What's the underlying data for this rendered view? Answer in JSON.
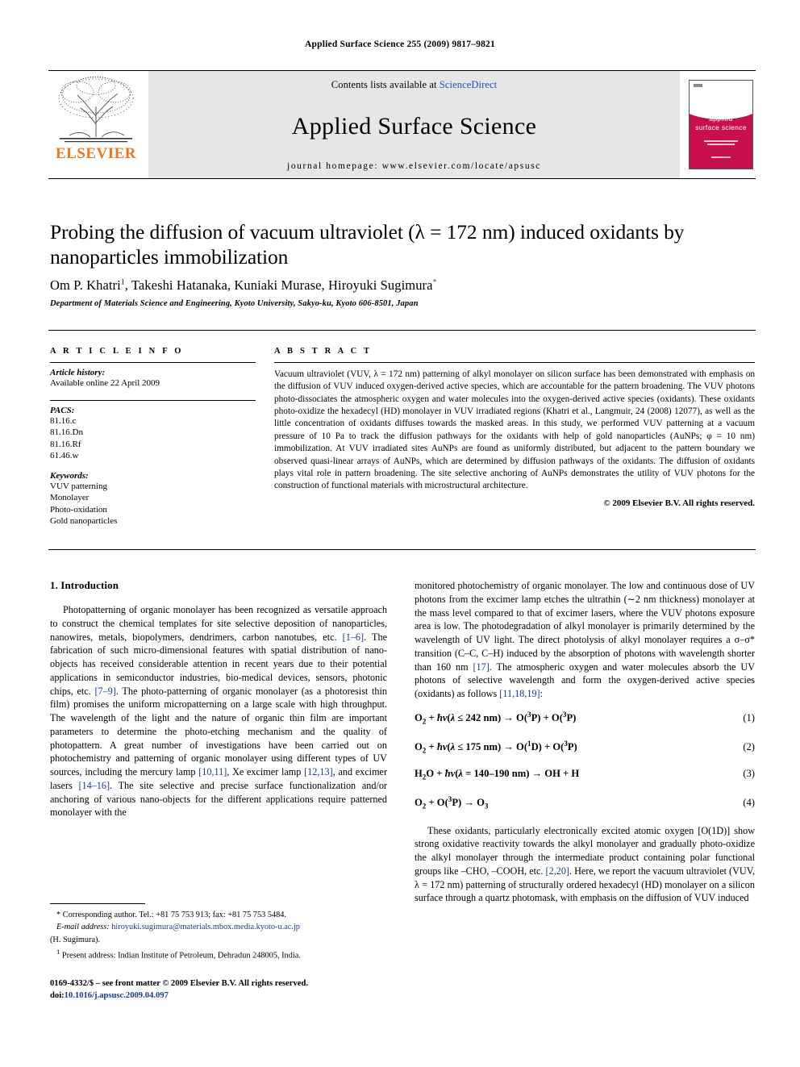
{
  "running_head": "Applied Surface Science 255 (2009) 9817–9821",
  "masthead": {
    "publisher": "ELSEVIER",
    "contents_prefix": "Contents lists available at ",
    "sciencedirect": "ScienceDirect",
    "journal_name": "Applied Surface Science",
    "homepage": "journal homepage: www.elsevier.com/locate/apsusc",
    "cover_title_line1": "applied",
    "cover_title_line2": "surface science",
    "cover_color": "#c8104e",
    "elsevier_orange": "#E87722",
    "link_color": "#1a4fbd"
  },
  "article": {
    "title": "Probing the diffusion of vacuum ultraviolet (λ = 172 nm) induced oxidants by nanoparticles immobilization",
    "authors_text": "Om P. Khatri",
    "authors_mid": ", Takeshi Hatanaka, Kuniaki Murase, Hiroyuki Sugimura",
    "author_footnote_marker": "1",
    "corresponding_marker": "*",
    "affiliation": "Department of Materials Science and Engineering, Kyoto University, Sakyo-ku, Kyoto 606-8501, Japan"
  },
  "article_info": {
    "heading": "A R T I C L E   I N F O",
    "history_label": "Article history:",
    "history_value": "Available online 22 April 2009",
    "pacs_label": "PACS:",
    "pacs": [
      "81.16.c",
      "81.16.Dn",
      "81.16.Rf",
      "61.46.w"
    ],
    "keywords_label": "Keywords:",
    "keywords": [
      "VUV patterning",
      "Monolayer",
      "Photo-oxidation",
      "Gold nanoparticles"
    ]
  },
  "abstract": {
    "heading": "A B S T R A C T",
    "text": "Vacuum ultraviolet (VUV, λ = 172 nm) patterning of alkyl monolayer on silicon surface has been demonstrated with emphasis on the diffusion of VUV induced oxygen-derived active species, which are accountable for the pattern broadening. The VUV photons photo-dissociates the atmospheric oxygen and water molecules into the oxygen-derived active species (oxidants). These oxidants photo-oxidize the hexadecyl (HD) monolayer in VUV irradiated regions (Khatri et al., Langmuir, 24 (2008) 12077), as well as the little concentration of oxidants diffuses towards the masked areas. In this study, we performed VUV patterning at a vacuum pressure of 10 Pa to track the diffusion pathways for the oxidants with help of gold nanoparticles (AuNPs; φ = 10 nm) immobilization. At VUV irradiated sites AuNPs are found as uniformly distributed, but adjacent to the pattern boundary we observed quasi-linear arrays of AuNPs, which are determined by diffusion pathways of the oxidants. The diffusion of oxidants plays vital role in pattern broadening. The site selective anchoring of AuNPs demonstrates the utility of VUV photons for the construction of functional materials with microstructural architecture.",
    "copyright": "© 2009 Elsevier B.V. All rights reserved."
  },
  "body": {
    "section_heading": "1. Introduction",
    "left_p1_a": "Photopatterning of organic monolayer has been recognized as versatile approach to construct the chemical templates for site selective deposition of nanoparticles, nanowires, metals, biopolymers, dendrimers, carbon nanotubes, etc. ",
    "left_ref1": "[1–6]",
    "left_p1_b": ". The fabrication of such micro-dimensional features with spatial distribution of nano-objects has received considerable attention in recent years due to their potential applications in semiconductor industries, bio-medical devices, sensors, photonic chips, etc. ",
    "left_ref2": "[7–9]",
    "left_p1_c": ". The photo-patterning of organic monolayer (as a photoresist thin film) promises the uniform micropatterning on a large scale with high throughput. The wavelength of the light and the nature of organic thin film are important parameters to determine the photo-etching mechanism and the quality of photopattern. A great number of investigations have been carried out on photochemistry and patterning of organic monolayer using different types of UV sources, including the mercury lamp ",
    "left_ref3": "[10,11]",
    "left_p1_d": ", Xe excimer lamp ",
    "left_ref4": "[12,13]",
    "left_p1_e": ", and excimer lasers ",
    "left_ref5": "[14–16]",
    "left_p1_f": ". The site selective and precise surface functionalization and/or anchoring of various nano-objects for the different applications require patterned monolayer with the",
    "right_p1_a": "monitored photochemistry of organic monolayer. The low and continuous dose of UV photons from the excimer lamp etches the ultrathin (∼2 nm thickness) monolayer at the mass level compared to that of excimer lasers, where the VUV photons exposure area is low. The photodegradation of alkyl monolayer is primarily determined by the wavelength of UV light. The direct photolysis of alkyl monolayer requires a σ–σ* transition (C–C, C–H) induced by the absorption of photons with wavelength shorter than 160 nm ",
    "right_ref1": "[17]",
    "right_p1_b": ". The atmospheric oxygen and water molecules absorb the UV photons of selective wavelength and form the oxygen-derived active species (oxidants) as follows ",
    "right_ref2": "[11,18,19]",
    "right_p1_c": ":",
    "right_p2_a": "These oxidants, particularly electronically excited atomic oxygen [O(1D)] show strong oxidative reactivity towards the alkyl monolayer and gradually photo-oxidize the alkyl monolayer through the intermediate product containing polar functional groups like –CHO, –COOH, etc. ",
    "right_ref3": "[2,20]",
    "right_p2_b": ". Here, we report the vacuum ultraviolet (VUV, λ = 172 nm) patterning of structurally ordered hexadecyl (HD) monolayer on a silicon surface through a quartz photomask, with emphasis on the diffusion of VUV induced"
  },
  "equations": [
    {
      "num": "(1)",
      "text": "O2 + ħν(λ ≤ 242 nm) → O(3P) + O(3P)"
    },
    {
      "num": "(2)",
      "text": "O2 + ħν(λ ≤ 175 nm) → O(1D) + O(3P)"
    },
    {
      "num": "(3)",
      "text": "H2O + ħν(λ = 140–190 nm) → OH + H"
    },
    {
      "num": "(4)",
      "text": "O2 + O(3P) → O3"
    }
  ],
  "footnotes": {
    "corresponding": "Corresponding author. Tel.: +81 75 753 913; fax: +81 75 753 5484.",
    "email_label": "E-mail address:",
    "email": "hiroyuki.sugimura@materials.mbox.media.kyoto-u.ac.jp",
    "email_suffix": "(H. Sugimura).",
    "present_address": "Present address: Indian Institute of Petroleum, Dehradun 248005, India."
  },
  "imprint": {
    "issn_line": "0169-4332/$ – see front matter © 2009 Elsevier B.V. All rights reserved.",
    "doi_label": "doi:",
    "doi_value": "10.1016/j.apsusc.2009.04.097"
  }
}
